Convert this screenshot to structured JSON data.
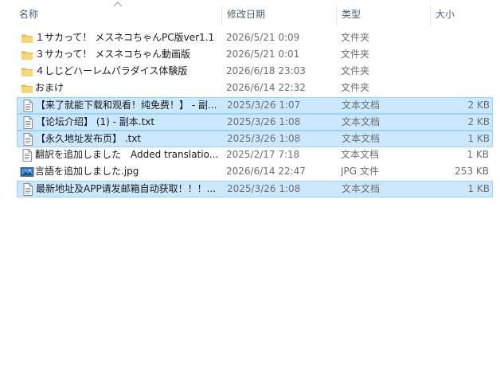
{
  "columns": {
    "name": "名称",
    "date": "修改日期",
    "type": "类型",
    "size": "大小"
  },
  "files": [
    {
      "name": "１サカって！ メスネコちゃんPC版ver1.1",
      "date": "2026/5/21 0:09",
      "type": "文件夹",
      "size": "",
      "icon": "folder-icon",
      "selected": false
    },
    {
      "name": "３サカって！ メスネコちゃん動画版",
      "date": "2026/5/21 0:01",
      "type": "文件夹",
      "size": "",
      "icon": "folder-icon",
      "selected": false
    },
    {
      "name": "４しじどハーレムパラダイス体験版",
      "date": "2026/6/18 23:03",
      "type": "文件夹",
      "size": "",
      "icon": "folder-icon",
      "selected": false
    },
    {
      "name": "おまけ",
      "date": "2026/6/14 22:32",
      "type": "文件夹",
      "size": "",
      "icon": "folder-icon",
      "selected": false
    },
    {
      "name": "【来了就能下载和观看！纯免费！】 - 副...",
      "date": "2025/3/26 1:07",
      "type": "文本文档",
      "size": "2 KB",
      "icon": "text-file-icon",
      "selected": true
    },
    {
      "name": "【论坛介绍】 (1) - 副本.txt",
      "date": "2025/3/26 1:08",
      "type": "文本文档",
      "size": "2 KB",
      "icon": "text-file-icon",
      "selected": true
    },
    {
      "name": "【永久地址发布页】 .txt",
      "date": "2025/3/26 1:08",
      "type": "文本文档",
      "size": "1 KB",
      "icon": "text-file-icon",
      "selected": true
    },
    {
      "name": "翻訳を追加しました　Added translatio...",
      "date": "2025/2/17 7:18",
      "type": "文本文档",
      "size": "1 KB",
      "icon": "text-file-icon",
      "selected": false
    },
    {
      "name": "言語を追加しました.jpg",
      "date": "2026/6/14 22:47",
      "type": "JPG 文件",
      "size": "253 KB",
      "icon": "image-file-icon",
      "selected": false
    },
    {
      "name": "最新地址及APP请发邮箱自动获取！！！...",
      "date": "2025/3/26 1:08",
      "type": "文本文档",
      "size": "1 KB",
      "icon": "text-file-icon",
      "selected": true
    }
  ],
  "colors": {
    "selection_bg": "#cce8ff",
    "selection_border": "#99d1ff",
    "folder": "#f8d775",
    "header_text": "#4c607a"
  }
}
